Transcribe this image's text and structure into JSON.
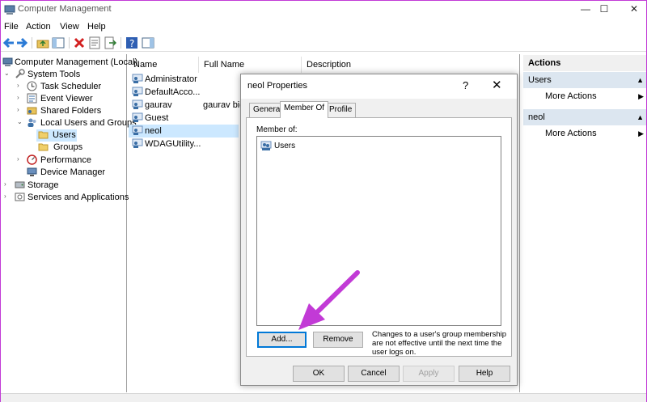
{
  "window": {
    "title": "Computer Management",
    "controls": {
      "minimize": "—",
      "maximize": "☐",
      "close": "✕"
    }
  },
  "menu": [
    "File",
    "Action",
    "View",
    "Help"
  ],
  "tree": {
    "root": "Computer Management (Local)",
    "system_tools": "System Tools",
    "task_scheduler": "Task Scheduler",
    "event_viewer": "Event Viewer",
    "shared_folders": "Shared Folders",
    "local_users": "Local Users and Groups",
    "users": "Users",
    "groups": "Groups",
    "performance": "Performance",
    "device_manager": "Device Manager",
    "storage": "Storage",
    "services": "Services and Applications"
  },
  "list": {
    "columns": [
      "Name",
      "Full Name",
      "Description"
    ],
    "rows": [
      {
        "name": "Administrator",
        "full": ""
      },
      {
        "name": "DefaultAcco...",
        "full": ""
      },
      {
        "name": "gaurav",
        "full": "gaurav bid"
      },
      {
        "name": "Guest",
        "full": ""
      },
      {
        "name": "neol",
        "full": ""
      },
      {
        "name": "WDAGUtility...",
        "full": ""
      }
    ]
  },
  "actions": {
    "header": "Actions",
    "sections": [
      {
        "title": "Users",
        "item": "More Actions"
      },
      {
        "title": "neol",
        "item": "More Actions"
      }
    ]
  },
  "dialog": {
    "title": "neol Properties",
    "help": "?",
    "close": "✕",
    "tabs": [
      "General",
      "Member Of",
      "Profile"
    ],
    "active_tab": "Member Of",
    "member_of_label": "Member of:",
    "members": [
      "Users"
    ],
    "add": "Add...",
    "remove": "Remove",
    "note": "Changes to a user's group membership are not effective until the next time the user logs on.",
    "ok": "OK",
    "cancel": "Cancel",
    "apply": "Apply",
    "help_btn": "Help"
  },
  "colors": {
    "selection": "#cce8ff",
    "actions_header": "#dce6f0",
    "annotation_arrow": "#c23ad6",
    "focus": "#0078d7"
  }
}
